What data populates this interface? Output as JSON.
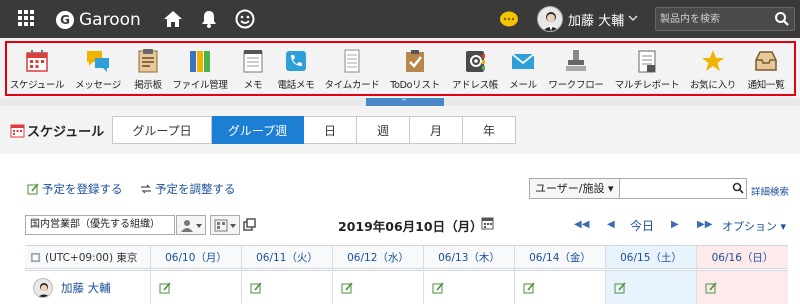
{
  "header": {
    "app_name": "Garoon",
    "user_name": "加藤 大輔",
    "search_placeholder": "製品内を検索"
  },
  "apps": [
    {
      "label": "スケジュール",
      "icon": "calendar-icon"
    },
    {
      "label": "メッセージ",
      "icon": "message-bubbles-icon"
    },
    {
      "label": "掲示板",
      "icon": "bulletin-board-icon"
    },
    {
      "label": "ファイル管理",
      "icon": "file-binders-icon"
    },
    {
      "label": "メモ",
      "icon": "memo-icon"
    },
    {
      "label": "電話メモ",
      "icon": "phone-memo-icon"
    },
    {
      "label": "タイムカード",
      "icon": "timecard-icon"
    },
    {
      "label": "ToDoリスト",
      "icon": "todo-clipboard-icon"
    },
    {
      "label": "アドレス帳",
      "icon": "address-book-icon"
    },
    {
      "label": "メール",
      "icon": "mail-envelope-icon"
    },
    {
      "label": "ワークフロー",
      "icon": "workflow-stamp-icon"
    },
    {
      "label": "マルチレポート",
      "icon": "multi-report-icon"
    },
    {
      "label": "お気に入り",
      "icon": "star-icon"
    },
    {
      "label": "通知一覧",
      "icon": "notification-tray-icon"
    }
  ],
  "collapse_glyph": "^",
  "schedule": {
    "title": "スケジュール",
    "tabs": [
      {
        "label": "グループ日",
        "active": false
      },
      {
        "label": "グループ週",
        "active": true
      },
      {
        "label": "日",
        "active": false
      },
      {
        "label": "週",
        "active": false
      },
      {
        "label": "月",
        "active": false
      },
      {
        "label": "年",
        "active": false
      }
    ]
  },
  "actions": {
    "register": "予定を登録する",
    "adjust": "予定を調整する",
    "facility_select": "ユーザー/施設",
    "detail_search": "詳細検索"
  },
  "week_nav": {
    "org": "国内営業部（優先する組織）",
    "date_title": "2019年06月10日（月）",
    "today": "今日",
    "options": "オプション"
  },
  "grid": {
    "timezone": "(UTC+09:00) 東京",
    "days": [
      {
        "label": "06/10（月）",
        "kind": "weekday"
      },
      {
        "label": "06/11（火）",
        "kind": "weekday"
      },
      {
        "label": "06/12（水）",
        "kind": "weekday"
      },
      {
        "label": "06/13（木）",
        "kind": "weekday"
      },
      {
        "label": "06/14（金）",
        "kind": "weekday"
      },
      {
        "label": "06/15（土）",
        "kind": "sat"
      },
      {
        "label": "06/16（日）",
        "kind": "sun"
      }
    ],
    "user": "加藤 大輔"
  },
  "colors": {
    "header_bg": "#3a3a3a",
    "highlight_frame": "#e60012",
    "active_tab": "#1d7fd3",
    "link": "#1a4f9c"
  }
}
